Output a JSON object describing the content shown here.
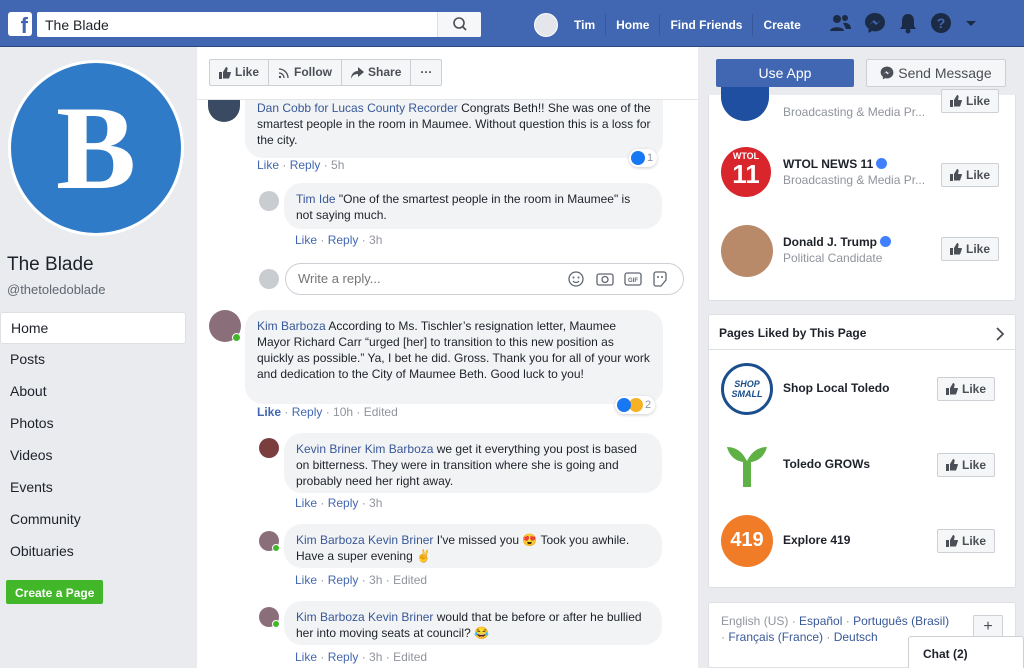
{
  "topbar": {
    "search_value": "The Blade",
    "user_name": "Tim",
    "nav_home": "Home",
    "nav_find_friends": "Find Friends",
    "nav_create": "Create"
  },
  "sidebar": {
    "page_name": "The Blade",
    "handle": "@thetoledoblade",
    "logo_letter": "B",
    "items": [
      "Home",
      "Posts",
      "About",
      "Photos",
      "Videos",
      "Events",
      "Community",
      "Obituaries"
    ],
    "create_page": "Create a Page"
  },
  "actionbar": {
    "like": "Like",
    "follow": "Follow",
    "share": "Share",
    "more": "···"
  },
  "comments": [
    {
      "author": "Dan Cobb for Lucas County Recorder",
      "text": " Congrats Beth!! She was one of the smartest people in the room in Maumee. Without question this is a loss for the city.",
      "like": "Like",
      "reply": "Reply",
      "time": "5h",
      "reactions": "1"
    },
    {
      "author": "Tim Ide",
      "text": " \"One of the smartest people in the room in Maumee\" is not saying much.",
      "like": "Like",
      "reply": "Reply",
      "time": "3h"
    },
    {
      "author": "Kim Barboza",
      "text": " According to Ms. Tischler’s resignation letter, Maumee Mayor Richard Carr “urged [her] to transition to this new position as quickly as possible.” Ya, I bet he did. Gross. Thank you for all of your work and dedication to the City of Maumee Beth. Good luck to you!",
      "like": "Like",
      "reply": "Reply",
      "time": "10h",
      "edited": "Edited",
      "reactions": "2"
    },
    {
      "author": "Kevin Briner",
      "mention": "Kim Barboza",
      "text": " we get it everything you post is based on bitterness. They were in transition where she is going and probably need her right away.",
      "like": "Like",
      "reply": "Reply",
      "time": "3h"
    },
    {
      "author": "Kim Barboza",
      "mention": "Kevin Briner",
      "text": " I've missed you 😍 Took you awhile. Have a super evening ✌",
      "like": "Like",
      "reply": "Reply",
      "time": "3h",
      "edited": "Edited"
    },
    {
      "author": "Kim Barboza",
      "mention": "Kevin Briner",
      "text": " would that be before or after he bullied her into moving seats at council? 😂",
      "like": "Like",
      "reply": "Reply",
      "time": "3h",
      "edited": "Edited"
    }
  ],
  "reply_placeholder": "Write a reply...",
  "right": {
    "use_app": "Use App",
    "send_message": "Send Message",
    "liked_pages_top": [
      {
        "name": "",
        "category": "Broadcasting & Media Pr...",
        "like": "Like"
      },
      {
        "name": "WTOL NEWS 11",
        "category": "Broadcasting & Media Pr...",
        "like": "Like",
        "logo_text": "WTOL"
      },
      {
        "name": "Donald J. Trump",
        "category": "Political Candidate",
        "like": "Like"
      }
    ],
    "pages_liked_title": "Pages Liked by This Page",
    "pages_liked": [
      {
        "name": "Shop Local Toledo",
        "like": "Like",
        "logo_text": "SHOP SMALL"
      },
      {
        "name": "Toledo GROWs",
        "like": "Like"
      },
      {
        "name": "Explore 419",
        "like": "Like",
        "logo_text": "419"
      }
    ],
    "languages": {
      "current": "English (US)",
      "l1": "Español",
      "l2": "Português (Brasil)",
      "l3": "Français (France)",
      "l4": "Deutsch"
    }
  },
  "chat": {
    "label": "Chat (2)"
  },
  "colors": {
    "brand": "#4267b2",
    "link": "#385898",
    "green": "#42b72a"
  }
}
